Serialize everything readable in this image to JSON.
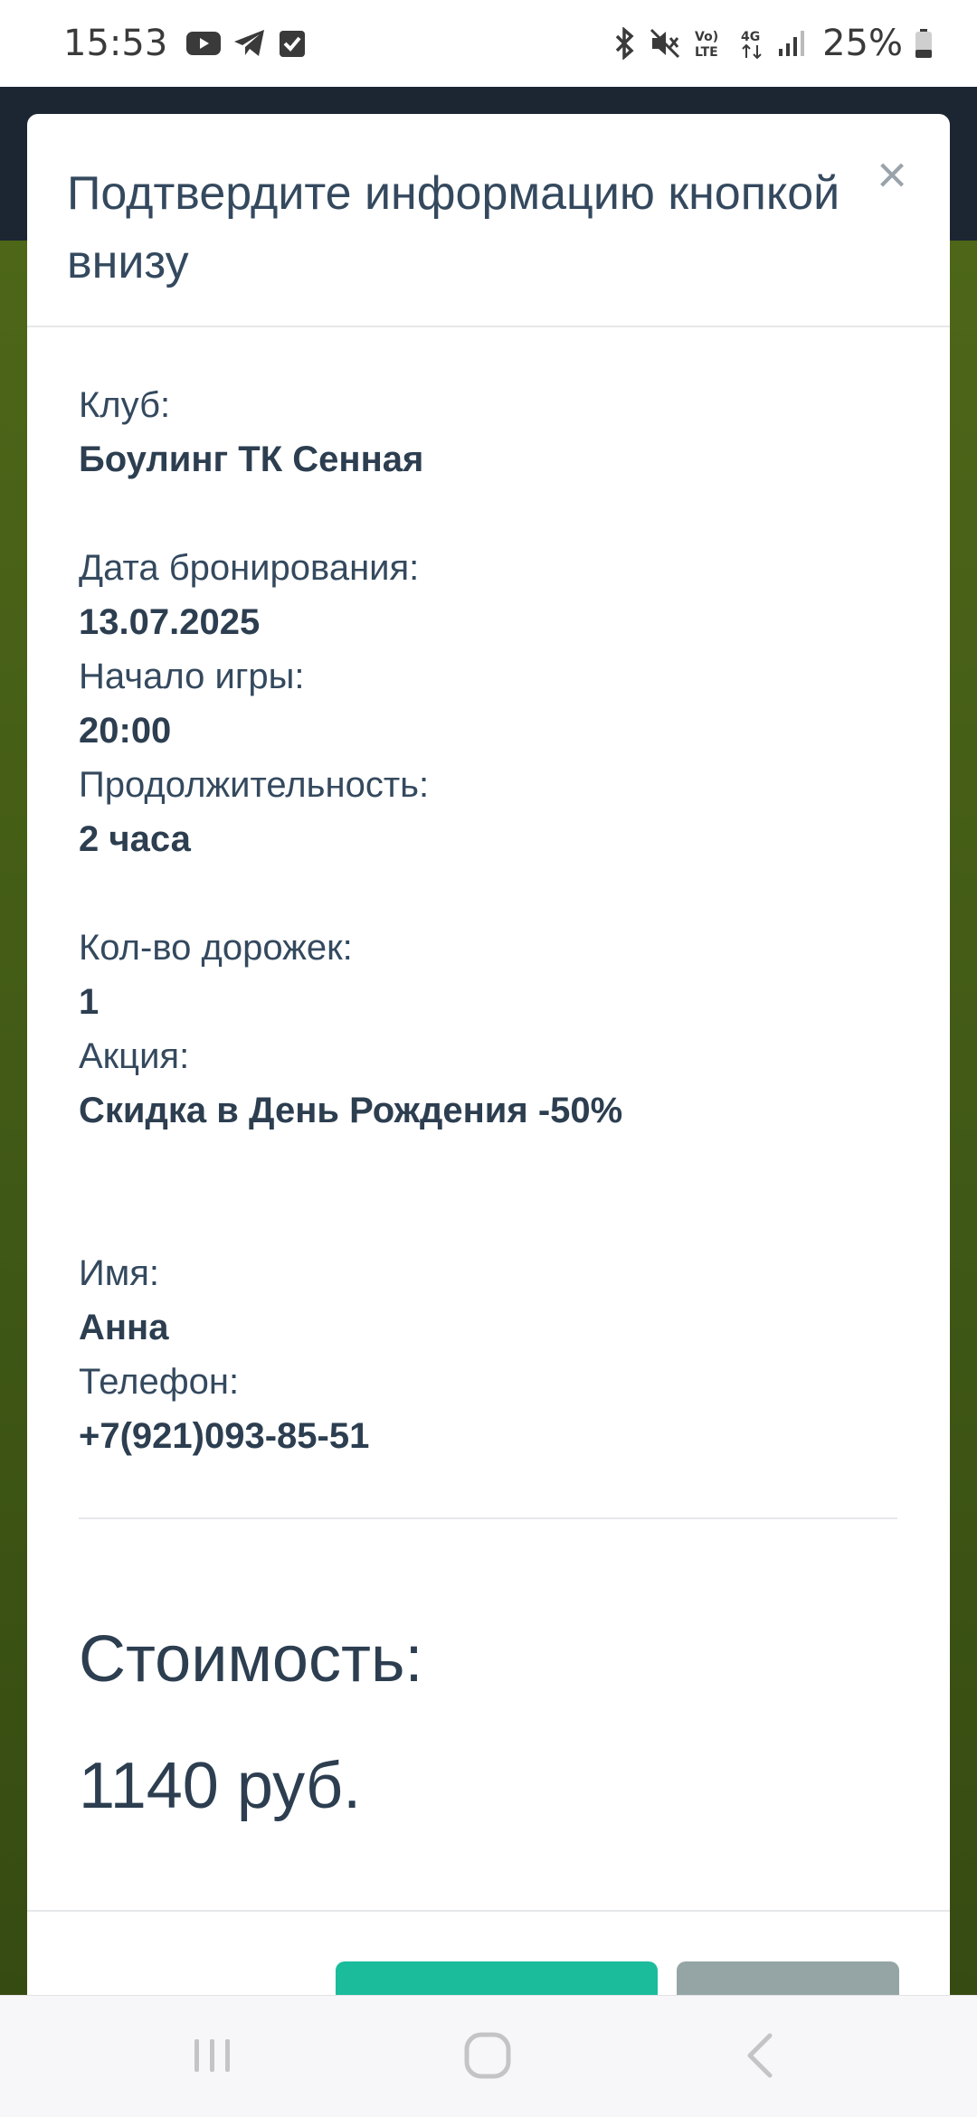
{
  "status_bar": {
    "time": "15:53",
    "left_icons": [
      "youtube-icon",
      "telegram-icon",
      "checkbox-icon"
    ],
    "right_icons": [
      "bluetooth-icon",
      "mute-icon",
      "volte-icon",
      "4g-icon",
      "signal-icon"
    ],
    "battery_percent": "25%"
  },
  "modal": {
    "title": "Подтвердите информацию кнопкой внизу",
    "fields": {
      "club_label": "Клуб:",
      "club_value": "Боулинг ТК Сенная",
      "date_label": "Дата бронирования:",
      "date_value": "13.07.2025",
      "start_label": "Начало игры:",
      "start_value": "20:00",
      "duration_label": "Продолжительность:",
      "duration_value": "2 часа",
      "lanes_label": "Кол-во дорожек:",
      "lanes_value": "1",
      "promo_label": "Акция:",
      "promo_value": "Скидка в День Рождения -50%",
      "name_label": "Имя:",
      "name_value": "Анна",
      "phone_label": "Телефон:",
      "phone_value": "+7(921)093-85-51"
    },
    "cost_label": "Стоимость:",
    "cost_value": "1140 руб.",
    "colors": {
      "confirm_button": "#1abc9c",
      "cancel_button": "#95a5a6",
      "text": "#34495e"
    }
  },
  "background": {
    "header_color": "#1c2633",
    "page_color": "#4d6618"
  },
  "nav_bar": {
    "buttons": [
      "recents-icon",
      "home-icon",
      "back-icon"
    ]
  }
}
